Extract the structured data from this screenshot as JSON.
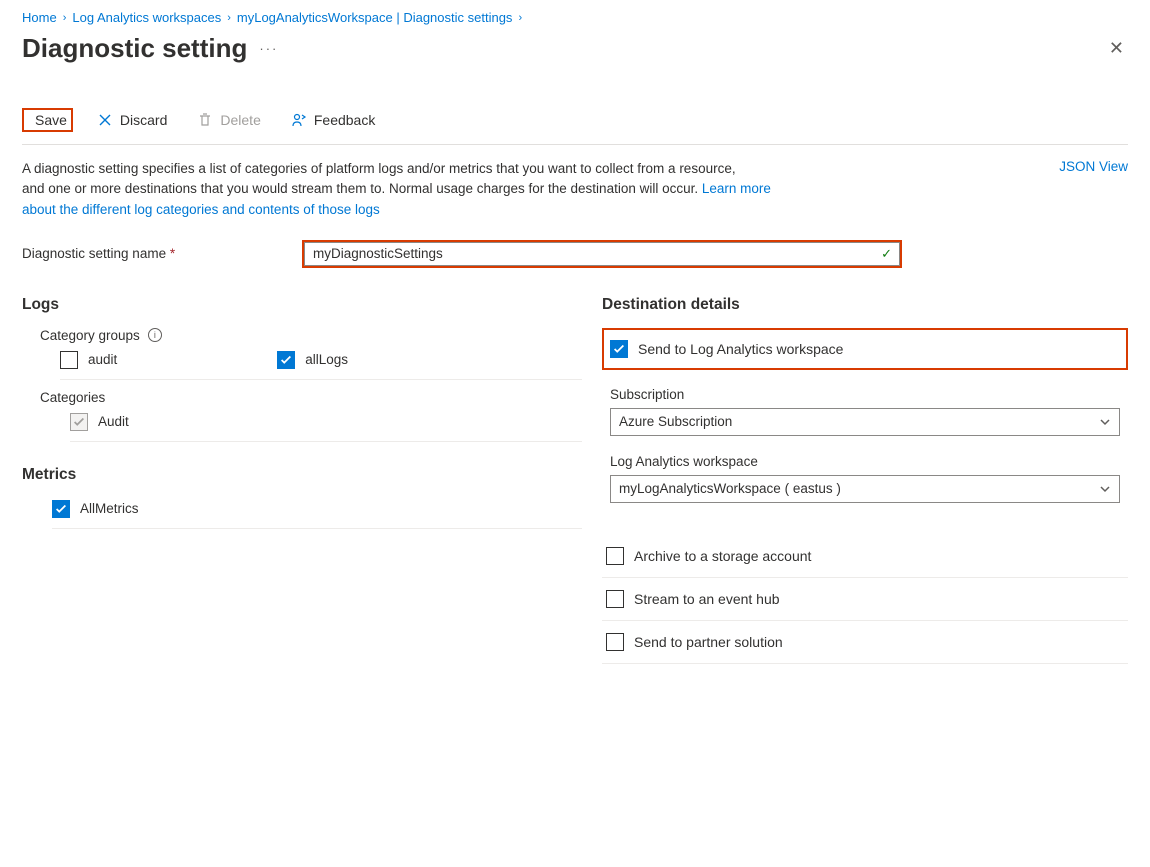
{
  "breadcrumb": [
    "Home",
    "Log Analytics workspaces",
    "myLogAnalyticsWorkspace | Diagnostic settings"
  ],
  "title": "Diagnostic setting",
  "toolbar": {
    "save": "Save",
    "discard": "Discard",
    "delete": "Delete",
    "feedback": "Feedback"
  },
  "json_view": "JSON View",
  "desc": {
    "line1": "A diagnostic setting specifies a list of categories of platform logs and/or metrics that you want to collect from a resource,",
    "line2": "and one or more destinations that you would stream them to. Normal usage charges for the destination will occur. ",
    "link": "Learn more about the different log categories and contents of those logs"
  },
  "name": {
    "label": "Diagnostic setting name",
    "value": "myDiagnosticSettings"
  },
  "logs": {
    "heading": "Logs",
    "category_groups_label": "Category groups",
    "audit": "audit",
    "alllogs": "allLogs",
    "categories_label": "Categories",
    "audit_cat": "Audit"
  },
  "metrics": {
    "heading": "Metrics",
    "allmetrics": "AllMetrics"
  },
  "dest": {
    "heading": "Destination details",
    "send_la": "Send to Log Analytics workspace",
    "subscription_label": "Subscription",
    "subscription_value": "Azure Subscription",
    "workspace_label": "Log Analytics workspace",
    "workspace_value": "myLogAnalyticsWorkspace ( eastus )",
    "archive": "Archive to a storage account",
    "stream": "Stream to an event hub",
    "partner": "Send to partner solution"
  }
}
